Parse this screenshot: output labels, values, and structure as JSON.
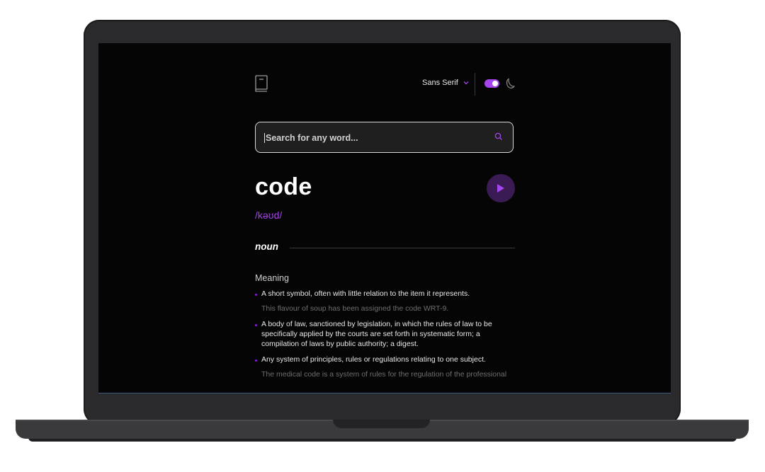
{
  "header": {
    "font_label": "Sans Serif",
    "theme_dark": true
  },
  "search": {
    "placeholder": "Search for any word..."
  },
  "entry": {
    "word": "code",
    "phonetic": "/kəʊd/",
    "part_of_speech": "noun",
    "meaning_heading": "Meaning",
    "definitions": [
      {
        "text": "A short symbol, often with little relation to the item it represents.",
        "example": "This flavour of soup has been assigned the code WRT-9."
      },
      {
        "text": "A body of law, sanctioned by legislation, in which the rules of law to be specifically applied by the courts are set forth in systematic form; a compilation of laws by public authority; a digest.",
        "example": ""
      },
      {
        "text": "Any system of principles, rules or regulations relating to one subject.",
        "example": "The medical code is a system of rules for the regulation of the professional"
      }
    ]
  },
  "colors": {
    "accent": "#a445ed",
    "screen_bg": "#050505",
    "play_bg": "#3b1b54"
  },
  "icons": [
    "book-logo-icon",
    "chevron-down-icon",
    "moon-icon",
    "search-icon",
    "play-icon"
  ]
}
